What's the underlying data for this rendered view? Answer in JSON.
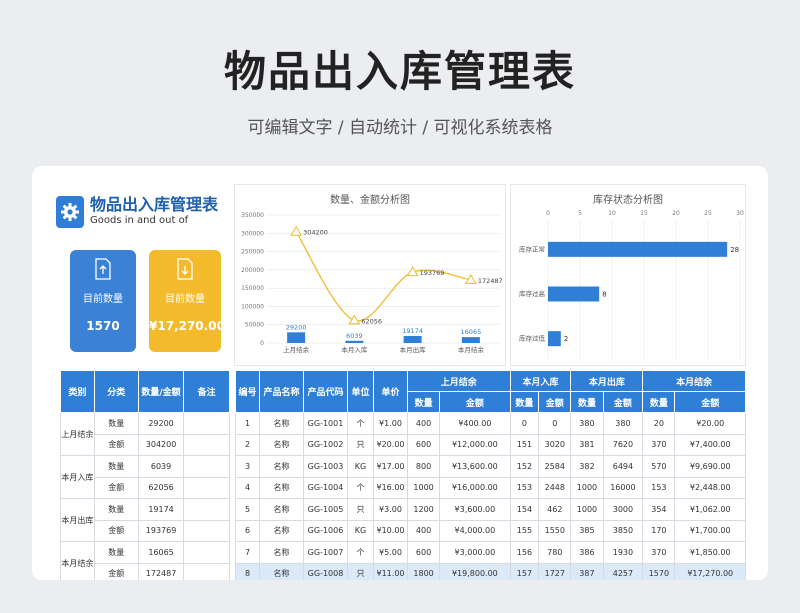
{
  "page": {
    "title": "物品出入库管理表",
    "subtitle": "可编辑文字 / 自动统计 / 可视化系统表格"
  },
  "brand": {
    "title": "物品出入库管理表",
    "subtitle_en": "Goods in and out of",
    "icon": "gear-icon"
  },
  "kpis": [
    {
      "label": "目前数量",
      "value": "1570",
      "icon": "upload-file-icon",
      "color": "#3b82d6"
    },
    {
      "label": "目前数量",
      "value": "¥17,270.00",
      "icon": "download-file-icon",
      "color": "#f3bb2c"
    }
  ],
  "colors": {
    "accent": "#2f7fd6",
    "line": "#f0bf3a",
    "highlight_row": "#dce9f8"
  },
  "chart_data": [
    {
      "type": "bar",
      "title": "数量、金额分析图",
      "categories": [
        "上月结余",
        "本月入库",
        "本月出库",
        "本月结余"
      ],
      "ylim": [
        0,
        350000
      ],
      "yticks": [
        "0",
        "50000",
        "100000",
        "150000",
        "200000",
        "250000",
        "300000",
        "350000"
      ],
      "series": [
        {
          "type": "bar",
          "values": [
            29200,
            6039,
            19174,
            16065
          ],
          "labels": [
            "29200",
            "6039",
            "19174",
            "16065"
          ]
        },
        {
          "type": "line",
          "values": [
            304200,
            62056,
            193769,
            172487
          ],
          "labels": [
            "304200",
            "62056",
            "193769",
            "172487"
          ]
        }
      ],
      "grid": true
    },
    {
      "type": "bar",
      "orientation": "horizontal",
      "title": "库存状态分析图",
      "categories": [
        "库存正常",
        "库存过高",
        "库存过低"
      ],
      "values": [
        28,
        8,
        2
      ],
      "labels": [
        "28",
        "8",
        "2"
      ],
      "xlim": [
        0,
        30
      ],
      "xticks": [
        "0",
        "5",
        "10",
        "15",
        "20",
        "25",
        "30"
      ],
      "grid": true
    }
  ],
  "summary_table": {
    "headers": [
      "类别",
      "分类",
      "数量/金额",
      "备注"
    ],
    "groups": [
      {
        "category": "上月结余",
        "rows": [
          {
            "kind": "数量",
            "value": "29200"
          },
          {
            "kind": "金额",
            "value": "304200"
          }
        ]
      },
      {
        "category": "本月入库",
        "rows": [
          {
            "kind": "数量",
            "value": "6039"
          },
          {
            "kind": "金额",
            "value": "62056"
          }
        ]
      },
      {
        "category": "本月出库",
        "rows": [
          {
            "kind": "数量",
            "value": "19174"
          },
          {
            "kind": "金额",
            "value": "193769"
          }
        ]
      },
      {
        "category": "本月结余",
        "rows": [
          {
            "kind": "数量",
            "value": "16065"
          },
          {
            "kind": "金额",
            "value": "172487"
          }
        ]
      }
    ]
  },
  "detail_table": {
    "headers": [
      "编号",
      "产品名称",
      "产品代码",
      "单位",
      "单价"
    ],
    "group_headers": [
      "上月结余",
      "本月入库",
      "本月出库",
      "本月结余"
    ],
    "sub_headers": [
      "数量",
      "金额"
    ],
    "rows": [
      [
        "1",
        "名称",
        "GG-1001",
        "个",
        "¥1.00",
        "400",
        "¥400.00",
        "0",
        "0",
        "380",
        "380",
        "20",
        "¥20.00"
      ],
      [
        "2",
        "名称",
        "GG-1002",
        "只",
        "¥20.00",
        "600",
        "¥12,000.00",
        "151",
        "3020",
        "381",
        "7620",
        "370",
        "¥7,400.00"
      ],
      [
        "3",
        "名称",
        "GG-1003",
        "KG",
        "¥17.00",
        "800",
        "¥13,600.00",
        "152",
        "2584",
        "382",
        "6494",
        "570",
        "¥9,690.00"
      ],
      [
        "4",
        "名称",
        "GG-1004",
        "个",
        "¥16.00",
        "1000",
        "¥16,000.00",
        "153",
        "2448",
        "1000",
        "16000",
        "153",
        "¥2,448.00"
      ],
      [
        "5",
        "名称",
        "GG-1005",
        "只",
        "¥3.00",
        "1200",
        "¥3,600.00",
        "154",
        "462",
        "1000",
        "3000",
        "354",
        "¥1,062.00"
      ],
      [
        "6",
        "名称",
        "GG-1006",
        "KG",
        "¥10.00",
        "400",
        "¥4,000.00",
        "155",
        "1550",
        "385",
        "3850",
        "170",
        "¥1,700.00"
      ],
      [
        "7",
        "名称",
        "GG-1007",
        "个",
        "¥5.00",
        "600",
        "¥3,000.00",
        "156",
        "780",
        "386",
        "1930",
        "370",
        "¥1,850.00"
      ],
      [
        "8",
        "名称",
        "GG-1008",
        "只",
        "¥11.00",
        "1800",
        "¥19,800.00",
        "157",
        "1727",
        "387",
        "4257",
        "1570",
        "¥17,270.00"
      ]
    ]
  }
}
